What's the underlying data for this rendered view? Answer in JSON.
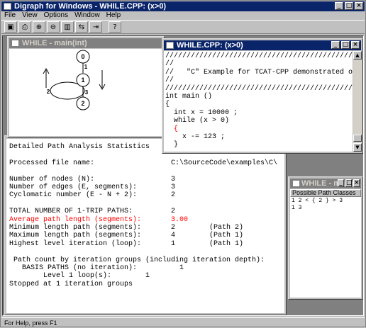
{
  "app": {
    "title": "Digraph for Windows - WHILE.CPP: (x>0)",
    "menu": [
      "File",
      "View",
      "Options",
      "Window",
      "Help"
    ],
    "toolbar_icons": [
      "open-icon",
      "print-icon",
      "zoom-in-icon",
      "zoom-out-icon",
      "tile-icon",
      "path-icon",
      "step-icon",
      "help-icon"
    ],
    "toolbar_glyphs": [
      "▣",
      "⎙",
      "⊕",
      "⊖",
      "▥",
      "⇆",
      "⇥",
      "?"
    ],
    "status": "For Help, press F1"
  },
  "graph_window": {
    "title": "WHILE - main(int)",
    "nodes": [
      "0",
      "1",
      "2"
    ],
    "edge_labels": [
      "1",
      "2",
      "3"
    ]
  },
  "code_window": {
    "title": "WHILE.CPP: (x>0)",
    "lines": [
      "////////////////////////////////////////////////",
      "//",
      "//   \"C\" Example for TCAT-CPP demonstrated on a",
      "//",
      "////////////////////////////////////////////////",
      "",
      "int main ()",
      "{",
      "  int x = 10000 ;",
      "  while (x > 0)",
      "  {",
      "    x -= 123 ;",
      "  }"
    ]
  },
  "stats_window": {
    "heading": "Detailed Path Analysis Statistics",
    "rows": [
      {
        "text": "",
        "red": false
      },
      {
        "text": "Processed file name:                  C:\\SourceCode\\examples\\C\\",
        "red": false
      },
      {
        "text": "",
        "red": false
      },
      {
        "text": "Number of nodes (N):                  3",
        "red": false
      },
      {
        "text": "Number of edges (E, segments):        3",
        "red": false
      },
      {
        "text": "Cyclomatic number (E - N + 2):        2",
        "red": false
      },
      {
        "text": "",
        "red": false
      },
      {
        "text": "TOTAL NUMBER OF 1-TRIP PATHS:         2",
        "red": false
      },
      {
        "text": "Average path length (segments):       3.00",
        "red": true
      },
      {
        "text": "Minimum length path (segments):       2        (Path 2)",
        "red": false
      },
      {
        "text": "Maximum length path (segments):       4        (Path 1)",
        "red": false
      },
      {
        "text": "Highest level iteration (loop):       1        (Path 1)",
        "red": false
      },
      {
        "text": "",
        "red": false
      },
      {
        "text": " Path count by iteration groups (including iteration depth):",
        "red": false
      },
      {
        "text": "   BASIS PATHS (no iteration):          1",
        "red": false
      },
      {
        "text": "        Level 1 loop(s):        1",
        "red": false
      },
      {
        "text": "Stopped at 1 iteration groups",
        "red": false
      }
    ]
  },
  "classes_window": {
    "title": "WHILE - main(...",
    "header": "Possible Path Classes",
    "items": [
      "1 2 < { 2 } > 3",
      "1 3"
    ]
  }
}
